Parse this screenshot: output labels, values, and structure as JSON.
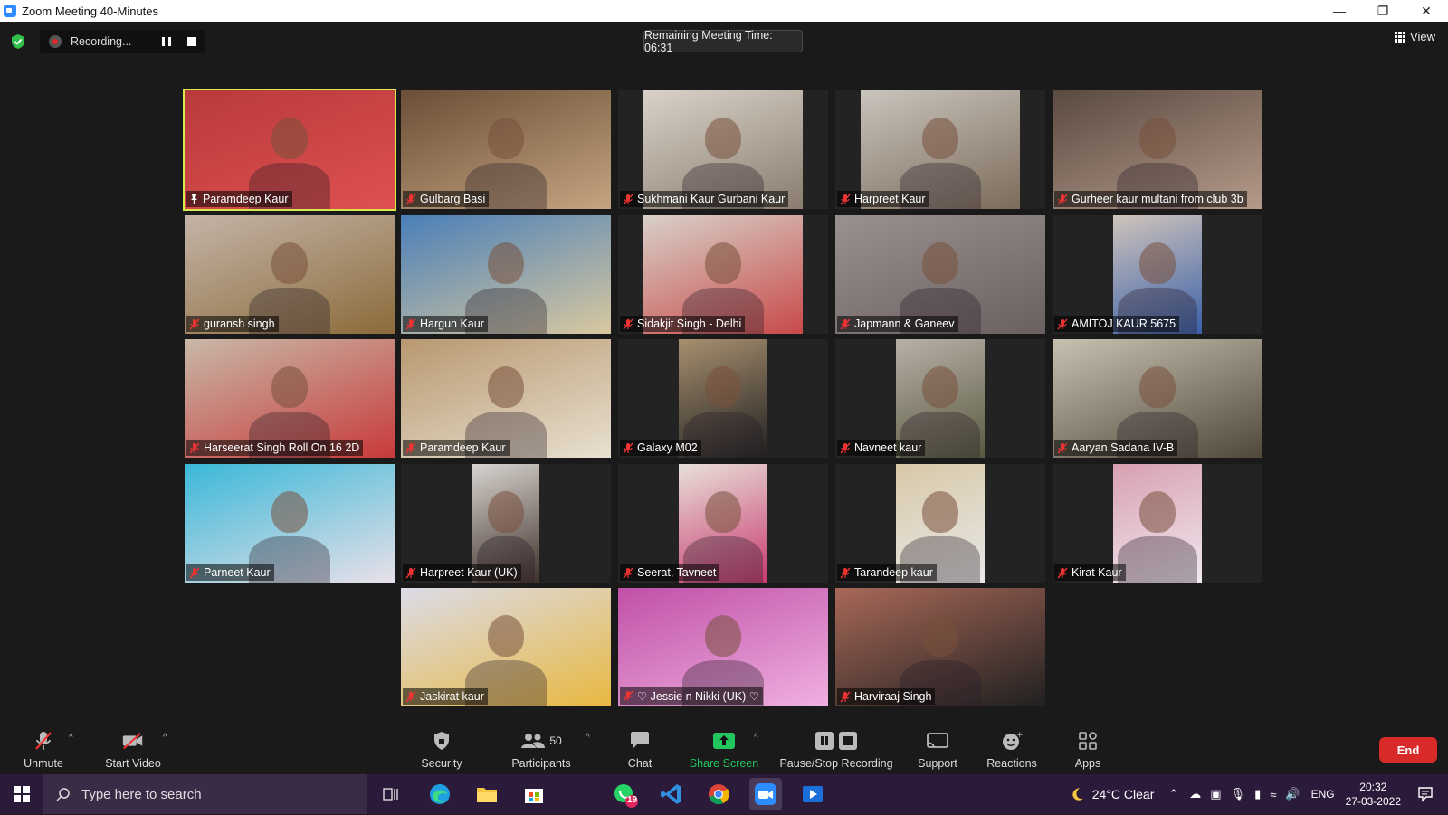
{
  "window": {
    "title": "Zoom Meeting 40-Minutes"
  },
  "top": {
    "recording_label": "Recording...",
    "timer_text": "Remaining Meeting Time: 06:31",
    "view_label": "View"
  },
  "participants": [
    {
      "name": "Paramdeep Kaur",
      "pinned": true
    },
    {
      "name": "Gulbarg Basi"
    },
    {
      "name": "Sukhmani Kaur Gurbani Kaur"
    },
    {
      "name": "Harpreet Kaur"
    },
    {
      "name": "Gurheer kaur multani from club 3b"
    },
    {
      "name": "guransh singh"
    },
    {
      "name": "Hargun Kaur"
    },
    {
      "name": "Sidakjit Singh - Delhi"
    },
    {
      "name": "Japmann & Ganeev"
    },
    {
      "name": "AMITOJ KAUR 5675"
    },
    {
      "name": "Harseerat Singh Roll On 16 2D"
    },
    {
      "name": "Paramdeep Kaur"
    },
    {
      "name": "Galaxy M02"
    },
    {
      "name": "Navneet kaur"
    },
    {
      "name": "Aaryan Sadana IV-B"
    },
    {
      "name": "Parneet Kaur"
    },
    {
      "name": "Harpreet Kaur (UK)"
    },
    {
      "name": "Seerat, Tavneet"
    },
    {
      "name": "Tarandeep kaur"
    },
    {
      "name": "Kirat Kaur"
    },
    {
      "name": "Jaskirat kaur"
    },
    {
      "name": "♡ Jessie n Nikki (UK) ♡"
    },
    {
      "name": "Harviraaj Singh"
    }
  ],
  "toolbar": {
    "unmute": "Unmute",
    "start_video": "Start Video",
    "security": "Security",
    "participants": "Participants",
    "participants_count": "50",
    "chat": "Chat",
    "share_screen": "Share Screen",
    "pause_stop_recording": "Pause/Stop Recording",
    "support": "Support",
    "reactions": "Reactions",
    "apps": "Apps",
    "end": "End"
  },
  "taskbar": {
    "search_placeholder": "Type here to search",
    "whatsapp_badge": "19",
    "weather": "24°C  Clear",
    "language": "ENG",
    "time": "20:32",
    "date": "27-03-2022"
  },
  "colors": {
    "share_green": "#22c55e",
    "end_red": "#d92a2a",
    "active_speaker": "#d9e84c",
    "taskbar": "#2b1a3a"
  }
}
